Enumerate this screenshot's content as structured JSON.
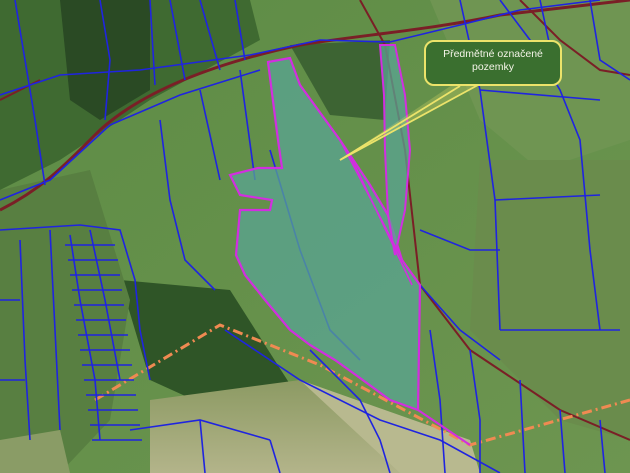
{
  "map": {
    "callout": {
      "line1": "Předmětné označené",
      "line2": "pozemky"
    },
    "colors": {
      "parcel_boundary": "#1f24e0",
      "highlighted_parcel_outline": "#d22ee0",
      "highlighted_parcel_fill": "#5aa493",
      "callout_border": "#ece36a",
      "road_outline": "#7a1f26",
      "railway_line": "#f08a52"
    },
    "layers": [
      "aerial-imagery",
      "cadastral-parcels",
      "highlighted-parcels",
      "roads",
      "railway"
    ]
  }
}
